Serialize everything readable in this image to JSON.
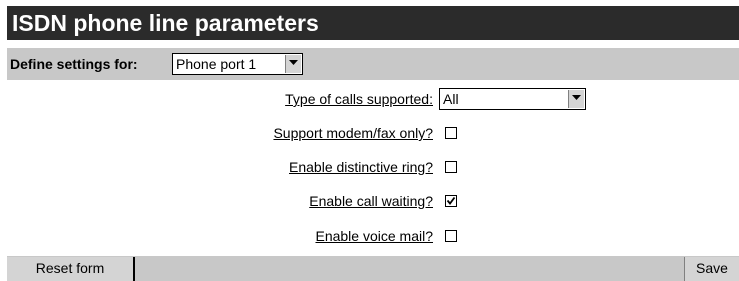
{
  "header": {
    "title": "ISDN phone line parameters"
  },
  "define_settings": {
    "label": "Define settings for:",
    "selected_port": "Phone port 1"
  },
  "form": {
    "call_types": {
      "label": "Type of calls supported:",
      "selected": "All"
    },
    "fields": [
      {
        "label": "Support modem/fax only?",
        "checked": false
      },
      {
        "label": "Enable distinctive ring?",
        "checked": false
      },
      {
        "label": "Enable call waiting?",
        "checked": true
      },
      {
        "label": "Enable voice mail?",
        "checked": false
      }
    ]
  },
  "buttons": {
    "reset_label": "Reset form",
    "save_label": "Save"
  },
  "colors": {
    "title_bg": "#2b2b2b",
    "bar_bg": "#c8c8c8",
    "button_bg": "#d4d4d4"
  }
}
